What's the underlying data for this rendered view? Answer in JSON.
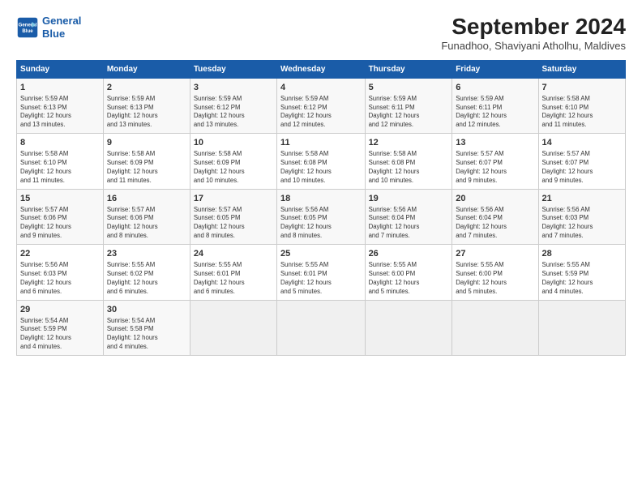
{
  "header": {
    "logo_line1": "General",
    "logo_line2": "Blue",
    "month": "September 2024",
    "location": "Funadhoo, Shaviyani Atholhu, Maldives"
  },
  "weekdays": [
    "Sunday",
    "Monday",
    "Tuesday",
    "Wednesday",
    "Thursday",
    "Friday",
    "Saturday"
  ],
  "weeks": [
    [
      {
        "day": "1",
        "info": "Sunrise: 5:59 AM\nSunset: 6:13 PM\nDaylight: 12 hours\nand 13 minutes."
      },
      {
        "day": "2",
        "info": "Sunrise: 5:59 AM\nSunset: 6:13 PM\nDaylight: 12 hours\nand 13 minutes."
      },
      {
        "day": "3",
        "info": "Sunrise: 5:59 AM\nSunset: 6:12 PM\nDaylight: 12 hours\nand 13 minutes."
      },
      {
        "day": "4",
        "info": "Sunrise: 5:59 AM\nSunset: 6:12 PM\nDaylight: 12 hours\nand 12 minutes."
      },
      {
        "day": "5",
        "info": "Sunrise: 5:59 AM\nSunset: 6:11 PM\nDaylight: 12 hours\nand 12 minutes."
      },
      {
        "day": "6",
        "info": "Sunrise: 5:59 AM\nSunset: 6:11 PM\nDaylight: 12 hours\nand 12 minutes."
      },
      {
        "day": "7",
        "info": "Sunrise: 5:58 AM\nSunset: 6:10 PM\nDaylight: 12 hours\nand 11 minutes."
      }
    ],
    [
      {
        "day": "8",
        "info": "Sunrise: 5:58 AM\nSunset: 6:10 PM\nDaylight: 12 hours\nand 11 minutes."
      },
      {
        "day": "9",
        "info": "Sunrise: 5:58 AM\nSunset: 6:09 PM\nDaylight: 12 hours\nand 11 minutes."
      },
      {
        "day": "10",
        "info": "Sunrise: 5:58 AM\nSunset: 6:09 PM\nDaylight: 12 hours\nand 10 minutes."
      },
      {
        "day": "11",
        "info": "Sunrise: 5:58 AM\nSunset: 6:08 PM\nDaylight: 12 hours\nand 10 minutes."
      },
      {
        "day": "12",
        "info": "Sunrise: 5:58 AM\nSunset: 6:08 PM\nDaylight: 12 hours\nand 10 minutes."
      },
      {
        "day": "13",
        "info": "Sunrise: 5:57 AM\nSunset: 6:07 PM\nDaylight: 12 hours\nand 9 minutes."
      },
      {
        "day": "14",
        "info": "Sunrise: 5:57 AM\nSunset: 6:07 PM\nDaylight: 12 hours\nand 9 minutes."
      }
    ],
    [
      {
        "day": "15",
        "info": "Sunrise: 5:57 AM\nSunset: 6:06 PM\nDaylight: 12 hours\nand 9 minutes."
      },
      {
        "day": "16",
        "info": "Sunrise: 5:57 AM\nSunset: 6:06 PM\nDaylight: 12 hours\nand 8 minutes."
      },
      {
        "day": "17",
        "info": "Sunrise: 5:57 AM\nSunset: 6:05 PM\nDaylight: 12 hours\nand 8 minutes."
      },
      {
        "day": "18",
        "info": "Sunrise: 5:56 AM\nSunset: 6:05 PM\nDaylight: 12 hours\nand 8 minutes."
      },
      {
        "day": "19",
        "info": "Sunrise: 5:56 AM\nSunset: 6:04 PM\nDaylight: 12 hours\nand 7 minutes."
      },
      {
        "day": "20",
        "info": "Sunrise: 5:56 AM\nSunset: 6:04 PM\nDaylight: 12 hours\nand 7 minutes."
      },
      {
        "day": "21",
        "info": "Sunrise: 5:56 AM\nSunset: 6:03 PM\nDaylight: 12 hours\nand 7 minutes."
      }
    ],
    [
      {
        "day": "22",
        "info": "Sunrise: 5:56 AM\nSunset: 6:03 PM\nDaylight: 12 hours\nand 6 minutes."
      },
      {
        "day": "23",
        "info": "Sunrise: 5:55 AM\nSunset: 6:02 PM\nDaylight: 12 hours\nand 6 minutes."
      },
      {
        "day": "24",
        "info": "Sunrise: 5:55 AM\nSunset: 6:01 PM\nDaylight: 12 hours\nand 6 minutes."
      },
      {
        "day": "25",
        "info": "Sunrise: 5:55 AM\nSunset: 6:01 PM\nDaylight: 12 hours\nand 5 minutes."
      },
      {
        "day": "26",
        "info": "Sunrise: 5:55 AM\nSunset: 6:00 PM\nDaylight: 12 hours\nand 5 minutes."
      },
      {
        "day": "27",
        "info": "Sunrise: 5:55 AM\nSunset: 6:00 PM\nDaylight: 12 hours\nand 5 minutes."
      },
      {
        "day": "28",
        "info": "Sunrise: 5:55 AM\nSunset: 5:59 PM\nDaylight: 12 hours\nand 4 minutes."
      }
    ],
    [
      {
        "day": "29",
        "info": "Sunrise: 5:54 AM\nSunset: 5:59 PM\nDaylight: 12 hours\nand 4 minutes."
      },
      {
        "day": "30",
        "info": "Sunrise: 5:54 AM\nSunset: 5:58 PM\nDaylight: 12 hours\nand 4 minutes."
      },
      {
        "day": "",
        "info": ""
      },
      {
        "day": "",
        "info": ""
      },
      {
        "day": "",
        "info": ""
      },
      {
        "day": "",
        "info": ""
      },
      {
        "day": "",
        "info": ""
      }
    ]
  ]
}
